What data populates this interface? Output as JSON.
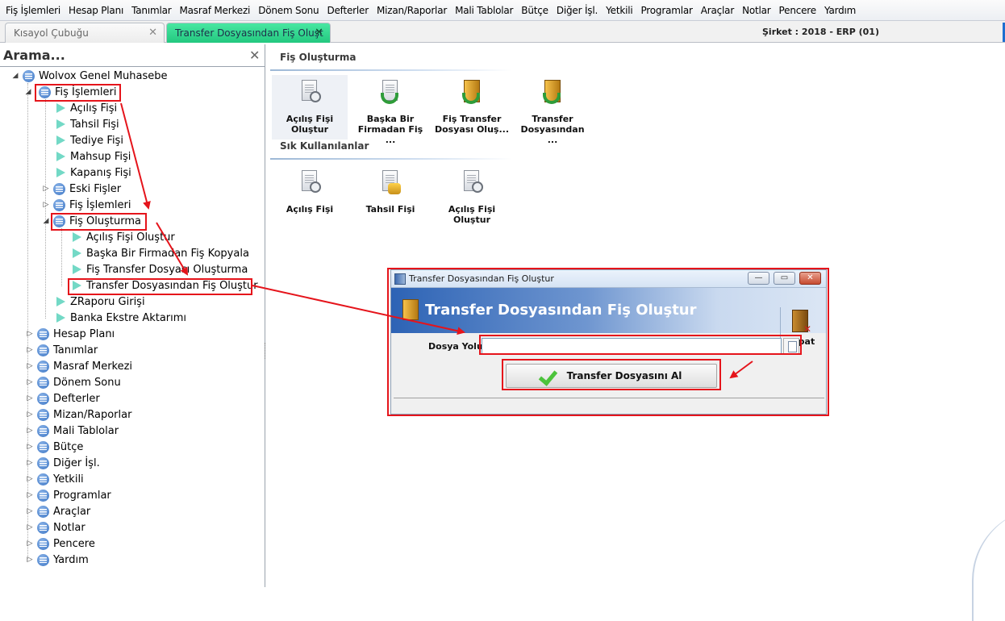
{
  "menubar": {
    "items": [
      "Fiş İşlemleri",
      "Hesap Planı",
      "Tanımlar",
      "Masraf Merkezi",
      "Dönem Sonu",
      "Defterler",
      "Mizan/Raporlar",
      "Mali Tablolar",
      "Bütçe",
      "Diğer İşl.",
      "Yetkili",
      "Programlar",
      "Araçlar",
      "Notlar",
      "Pencere",
      "Yardım"
    ]
  },
  "tabs": [
    {
      "label": "Kısayol Çubuğu"
    },
    {
      "label": "Transfer Dosyasından Fiş Oluşt"
    }
  ],
  "company": "Şirket : 2018 - ERP (01)",
  "search": {
    "title": "Arama...",
    "close": "✕"
  },
  "tree": {
    "root": "Wolvox Genel Muhasebe",
    "fis_islemleri": "Fiş İşlemleri",
    "acilis_fisi": "Açılış Fişi",
    "tahsil_fisi": "Tahsil Fişi",
    "tediye_fisi": "Tediye Fişi",
    "mahsup_fisi": "Mahsup Fişi",
    "kapanis_fisi": "Kapanış Fişi",
    "eski_fisler": "Eski Fişler",
    "fis_islemleri2": "Fiş İşlemleri",
    "fis_olusturma": "Fiş Oluşturma",
    "acilis_fisi_olustur": "Açılış Fişi Oluştur",
    "baska_bir_firma": "Başka Bir Firmadan Fiş Kopyala",
    "fis_transfer_dosyasi": "Fiş Transfer Dosyası Oluşturma",
    "transfer_dosyasindan": "Transfer Dosyasından Fiş Oluştur",
    "zraporu": "ZRaporu Girişi",
    "banka_ekstre": "Banka Ekstre Aktarımı",
    "hesap_plani": "Hesap Planı",
    "tanimlar": "Tanımlar",
    "masraf_merkezi": "Masraf Merkezi",
    "donem_sonu": "Dönem Sonu",
    "defterler": "Defterler",
    "mizan_raporlar": "Mizan/Raporlar",
    "mali_tablolar": "Mali Tablolar",
    "butce": "Bütçe",
    "diger_isl": "Diğer İşl.",
    "yetkili": "Yetkili",
    "programlar": "Programlar",
    "araclar": "Araçlar",
    "notlar": "Notlar",
    "pencere": "Pencere",
    "yardim": "Yardım"
  },
  "content": {
    "section1_title": "Fiş Oluşturma",
    "section1_items": [
      {
        "line1": "Açılış Fişi",
        "line2": "Oluştur"
      },
      {
        "line1": "Başka Bir",
        "line2": "Firmadan Fiş ..."
      },
      {
        "line1": "Fiş Transfer",
        "line2": "Dosyası Oluş..."
      },
      {
        "line1": "Transfer",
        "line2": "Dosyasından ..."
      }
    ],
    "section2_title": "Sık Kullanılanlar",
    "section2_items": [
      {
        "line1": "Açılış Fişi",
        "line2": ""
      },
      {
        "line1": "Tahsil Fişi",
        "line2": ""
      },
      {
        "line1": "Açılış Fişi",
        "line2": "Oluştur"
      }
    ]
  },
  "dialog": {
    "window_title": "Transfer Dosyasından Fiş Oluştur",
    "header_title": "Transfer Dosyasından Fiş Oluştur",
    "kapat_label": "Kapat",
    "dosya_yolu_label": "Dosya Yolu",
    "dosya_yolu_value": "",
    "transfer_button_label": "Transfer Dosyasını Al",
    "minimize": "—",
    "restore": "▭",
    "close": "✕"
  },
  "colors": {
    "active_tab": "#2fd48c",
    "annotation_red": "#e5141b",
    "dialog_header_blue": "#2d63b5"
  }
}
